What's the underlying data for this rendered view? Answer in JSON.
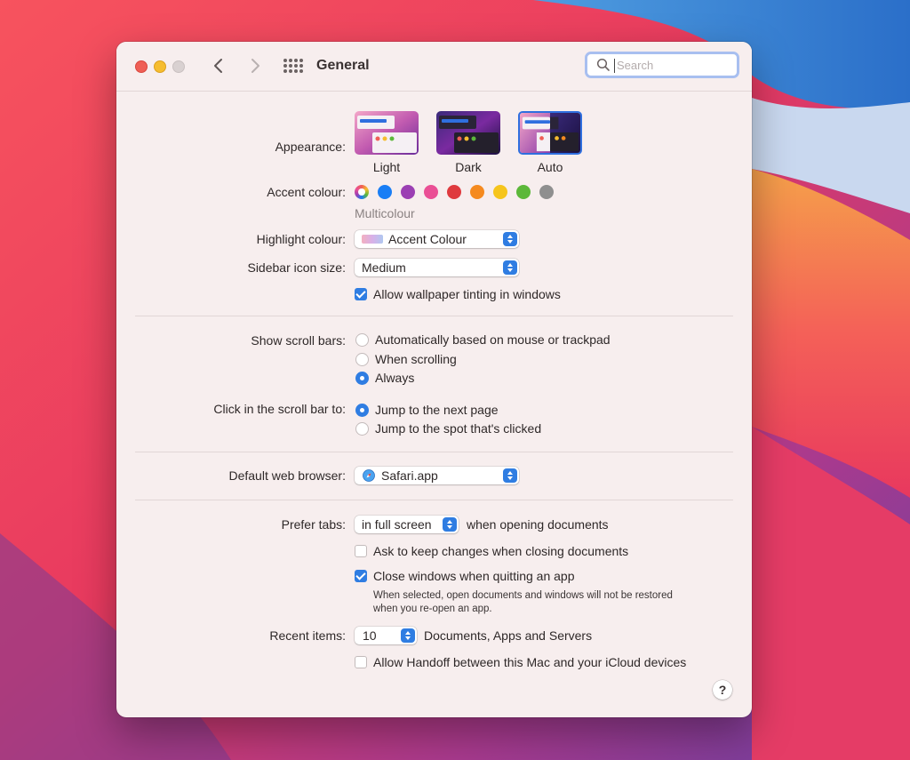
{
  "window": {
    "title": "General"
  },
  "search": {
    "placeholder": "Search"
  },
  "appearance": {
    "label": "Appearance:",
    "options": [
      "Light",
      "Dark",
      "Auto"
    ],
    "selected": "Auto"
  },
  "accent": {
    "label": "Accent colour:",
    "selected_name": "Multicolour",
    "colors": [
      "#1a7ef5",
      "#9b3fb3",
      "#ea4f95",
      "#df3a3e",
      "#f58a1f",
      "#f6c51c",
      "#5cb83a",
      "#8f8f8f"
    ]
  },
  "highlight": {
    "label": "Highlight colour:",
    "value": "Accent Colour"
  },
  "sidebar_icon": {
    "label": "Sidebar icon size:",
    "value": "Medium"
  },
  "wallpaper_tinting": {
    "label": "Allow wallpaper tinting in windows",
    "checked": true
  },
  "scroll_bars": {
    "label": "Show scroll bars:",
    "options": [
      "Automatically based on mouse or trackpad",
      "When scrolling",
      "Always"
    ],
    "selected": "Always"
  },
  "click_scroll": {
    "label": "Click in the scroll bar to:",
    "options": [
      "Jump to the next page",
      "Jump to the spot that's clicked"
    ],
    "selected": "Jump to the next page"
  },
  "browser": {
    "label": "Default web browser:",
    "value": "Safari.app"
  },
  "prefer_tabs": {
    "label": "Prefer tabs:",
    "value": "in full screen",
    "suffix": "when opening documents"
  },
  "ask_keep_changes": {
    "label": "Ask to keep changes when closing documents",
    "checked": false
  },
  "close_windows": {
    "label": "Close windows when quitting an app",
    "checked": true,
    "help_line1": "When selected, open documents and windows will not be restored",
    "help_line2": "when you re-open an app."
  },
  "recent_items": {
    "label": "Recent items:",
    "value": "10",
    "suffix": "Documents, Apps and Servers"
  },
  "handoff": {
    "label": "Allow Handoff between this Mac and your iCloud devices",
    "checked": false
  },
  "help_button": {
    "label": "?"
  },
  "icons": [
    "close-dot-icon",
    "minimize-dot-icon",
    "zoom-dot-icon",
    "chevron-left-icon",
    "chevron-right-icon",
    "grid-icon",
    "search-icon",
    "safari-icon",
    "help-icon"
  ]
}
